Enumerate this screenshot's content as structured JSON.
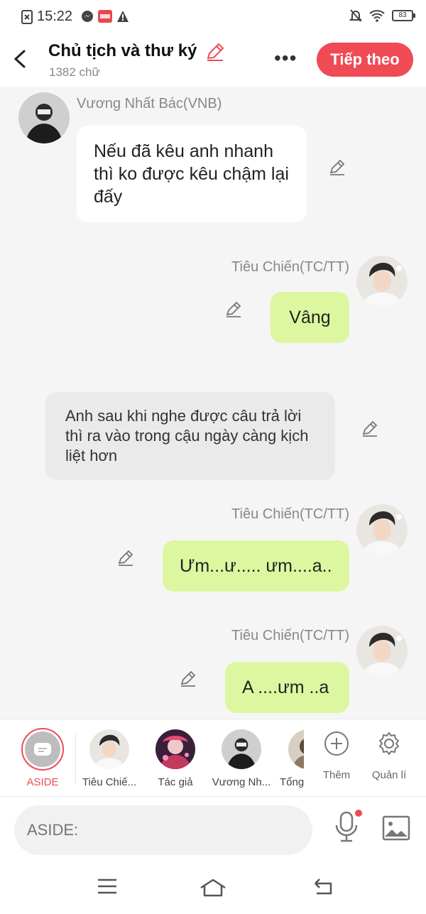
{
  "status": {
    "time": "15:22",
    "battery": "83"
  },
  "header": {
    "title": "Chủ tịch và thư ký",
    "word_count": "1382 chữ",
    "next_label": "Tiếp theo"
  },
  "messages": {
    "m1": {
      "sender": "Vương Nhất Bác(VNB)",
      "text": "Nếu đã kêu anh nhanh thì ko được kêu chậm lại đấy"
    },
    "m2": {
      "sender": "Tiêu Chiến(TC/TT)",
      "text": "Vâng"
    },
    "m3": {
      "text": "Anh sau khi nghe được câu trả lời thì ra vào trong cậu ngày càng kịch liệt hơn"
    },
    "m4": {
      "sender": "Tiêu Chiến(TC/TT)",
      "text": "Ưm...ư..... ưm....a.."
    },
    "m5": {
      "sender": "Tiêu Chiến(TC/TT)",
      "text": "A ....ưm ..a"
    }
  },
  "characters": {
    "aside": "ASIDE",
    "c1": "Tiêu Chiế...",
    "c2": "Tác giả",
    "c3": "Vương Nh...",
    "c4": "Tổng",
    "add": "Thêm",
    "manage": "Quản lí"
  },
  "input": {
    "placeholder": "ASIDE:"
  },
  "colors": {
    "accent": "#ef4b55",
    "green_bubble": "#dcf7a0"
  }
}
